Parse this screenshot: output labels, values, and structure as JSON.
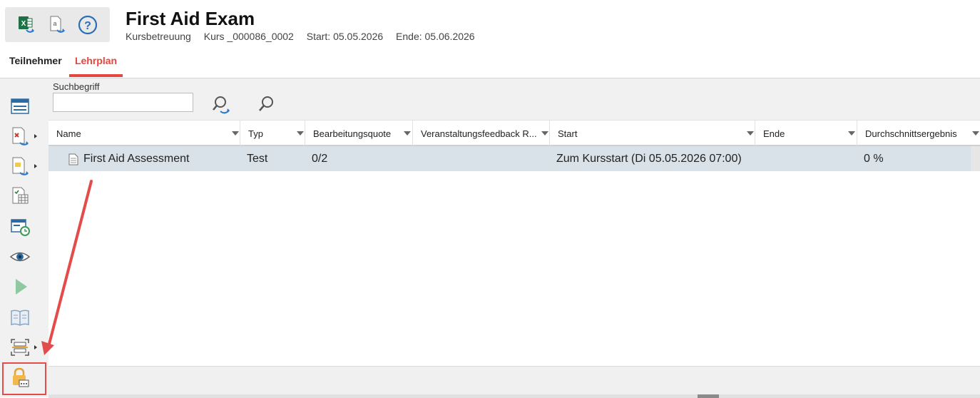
{
  "header": {
    "title": "First Aid Exam",
    "meta": {
      "kursbetreuung": "Kursbetreuung",
      "kurs": "Kurs _000086_0002",
      "start": "Start: 05.05.2026",
      "ende": "Ende: 05.06.2026"
    },
    "toolbox_icons": [
      "excel-export-icon",
      "document-export-icon",
      "help-icon"
    ]
  },
  "tabs": [
    {
      "label": "Teilnehmer",
      "active": false
    },
    {
      "label": "Lehrplan",
      "active": true
    }
  ],
  "search": {
    "label": "Suchbegriff",
    "value": "",
    "placeholder": ""
  },
  "grid": {
    "columns": [
      {
        "label": "Name"
      },
      {
        "label": "Typ"
      },
      {
        "label": "Bearbeitungsquote"
      },
      {
        "label": "Veranstaltungsfeedback R..."
      },
      {
        "label": "Start"
      },
      {
        "label": "Ende"
      },
      {
        "label": "Durchschnittsergebnis"
      }
    ],
    "rows": [
      {
        "name": "First Aid Assessment",
        "typ": "Test",
        "bearbeitungsquote": "0/2",
        "feedback": "",
        "start": "Zum Kursstart (Di 05.05.2026 07:00)",
        "ende": "",
        "durchschnitt": "0 %"
      }
    ]
  },
  "sidebar_icons": [
    "list-view-icon",
    "remove-user-icon",
    "assign-icon",
    "schedule-icon",
    "history-icon",
    "eye-icon",
    "play-icon",
    "book-icon",
    "scan-icon",
    "lock-icon"
  ],
  "colors": {
    "accent": "#e8453c",
    "row_selected": "#d9e2e9",
    "sidebar_bg": "#f1f1f1",
    "annotation": "#e44b4b"
  }
}
